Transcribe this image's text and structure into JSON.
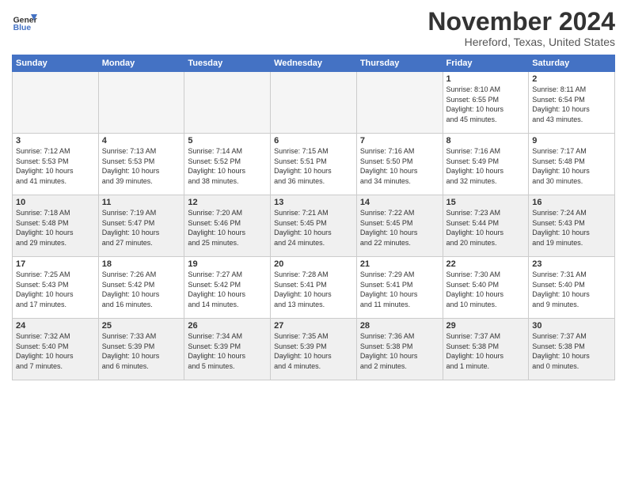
{
  "logo": {
    "line1": "General",
    "line2": "Blue"
  },
  "title": "November 2024",
  "location": "Hereford, Texas, United States",
  "header": {
    "days": [
      "Sunday",
      "Monday",
      "Tuesday",
      "Wednesday",
      "Thursday",
      "Friday",
      "Saturday"
    ]
  },
  "weeks": [
    [
      {
        "day": "",
        "info": ""
      },
      {
        "day": "",
        "info": ""
      },
      {
        "day": "",
        "info": ""
      },
      {
        "day": "",
        "info": ""
      },
      {
        "day": "",
        "info": ""
      },
      {
        "day": "1",
        "info": "Sunrise: 8:10 AM\nSunset: 6:55 PM\nDaylight: 10 hours\nand 45 minutes."
      },
      {
        "day": "2",
        "info": "Sunrise: 8:11 AM\nSunset: 6:54 PM\nDaylight: 10 hours\nand 43 minutes."
      }
    ],
    [
      {
        "day": "3",
        "info": "Sunrise: 7:12 AM\nSunset: 5:53 PM\nDaylight: 10 hours\nand 41 minutes."
      },
      {
        "day": "4",
        "info": "Sunrise: 7:13 AM\nSunset: 5:53 PM\nDaylight: 10 hours\nand 39 minutes."
      },
      {
        "day": "5",
        "info": "Sunrise: 7:14 AM\nSunset: 5:52 PM\nDaylight: 10 hours\nand 38 minutes."
      },
      {
        "day": "6",
        "info": "Sunrise: 7:15 AM\nSunset: 5:51 PM\nDaylight: 10 hours\nand 36 minutes."
      },
      {
        "day": "7",
        "info": "Sunrise: 7:16 AM\nSunset: 5:50 PM\nDaylight: 10 hours\nand 34 minutes."
      },
      {
        "day": "8",
        "info": "Sunrise: 7:16 AM\nSunset: 5:49 PM\nDaylight: 10 hours\nand 32 minutes."
      },
      {
        "day": "9",
        "info": "Sunrise: 7:17 AM\nSunset: 5:48 PM\nDaylight: 10 hours\nand 30 minutes."
      }
    ],
    [
      {
        "day": "10",
        "info": "Sunrise: 7:18 AM\nSunset: 5:48 PM\nDaylight: 10 hours\nand 29 minutes."
      },
      {
        "day": "11",
        "info": "Sunrise: 7:19 AM\nSunset: 5:47 PM\nDaylight: 10 hours\nand 27 minutes."
      },
      {
        "day": "12",
        "info": "Sunrise: 7:20 AM\nSunset: 5:46 PM\nDaylight: 10 hours\nand 25 minutes."
      },
      {
        "day": "13",
        "info": "Sunrise: 7:21 AM\nSunset: 5:45 PM\nDaylight: 10 hours\nand 24 minutes."
      },
      {
        "day": "14",
        "info": "Sunrise: 7:22 AM\nSunset: 5:45 PM\nDaylight: 10 hours\nand 22 minutes."
      },
      {
        "day": "15",
        "info": "Sunrise: 7:23 AM\nSunset: 5:44 PM\nDaylight: 10 hours\nand 20 minutes."
      },
      {
        "day": "16",
        "info": "Sunrise: 7:24 AM\nSunset: 5:43 PM\nDaylight: 10 hours\nand 19 minutes."
      }
    ],
    [
      {
        "day": "17",
        "info": "Sunrise: 7:25 AM\nSunset: 5:43 PM\nDaylight: 10 hours\nand 17 minutes."
      },
      {
        "day": "18",
        "info": "Sunrise: 7:26 AM\nSunset: 5:42 PM\nDaylight: 10 hours\nand 16 minutes."
      },
      {
        "day": "19",
        "info": "Sunrise: 7:27 AM\nSunset: 5:42 PM\nDaylight: 10 hours\nand 14 minutes."
      },
      {
        "day": "20",
        "info": "Sunrise: 7:28 AM\nSunset: 5:41 PM\nDaylight: 10 hours\nand 13 minutes."
      },
      {
        "day": "21",
        "info": "Sunrise: 7:29 AM\nSunset: 5:41 PM\nDaylight: 10 hours\nand 11 minutes."
      },
      {
        "day": "22",
        "info": "Sunrise: 7:30 AM\nSunset: 5:40 PM\nDaylight: 10 hours\nand 10 minutes."
      },
      {
        "day": "23",
        "info": "Sunrise: 7:31 AM\nSunset: 5:40 PM\nDaylight: 10 hours\nand 9 minutes."
      }
    ],
    [
      {
        "day": "24",
        "info": "Sunrise: 7:32 AM\nSunset: 5:40 PM\nDaylight: 10 hours\nand 7 minutes."
      },
      {
        "day": "25",
        "info": "Sunrise: 7:33 AM\nSunset: 5:39 PM\nDaylight: 10 hours\nand 6 minutes."
      },
      {
        "day": "26",
        "info": "Sunrise: 7:34 AM\nSunset: 5:39 PM\nDaylight: 10 hours\nand 5 minutes."
      },
      {
        "day": "27",
        "info": "Sunrise: 7:35 AM\nSunset: 5:39 PM\nDaylight: 10 hours\nand 4 minutes."
      },
      {
        "day": "28",
        "info": "Sunrise: 7:36 AM\nSunset: 5:38 PM\nDaylight: 10 hours\nand 2 minutes."
      },
      {
        "day": "29",
        "info": "Sunrise: 7:37 AM\nSunset: 5:38 PM\nDaylight: 10 hours\nand 1 minute."
      },
      {
        "day": "30",
        "info": "Sunrise: 7:37 AM\nSunset: 5:38 PM\nDaylight: 10 hours\nand 0 minutes."
      }
    ]
  ]
}
